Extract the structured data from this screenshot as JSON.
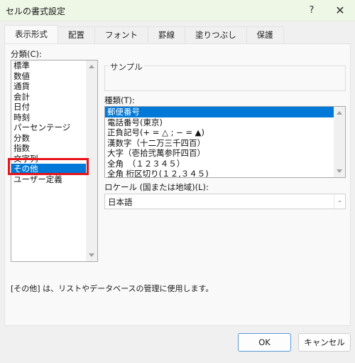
{
  "window": {
    "title": "セルの書式設定",
    "help_label": "?",
    "close_label": "✕"
  },
  "tabs": [
    {
      "label": "表示形式",
      "active": true
    },
    {
      "label": "配置",
      "active": false
    },
    {
      "label": "フォント",
      "active": false
    },
    {
      "label": "罫線",
      "active": false
    },
    {
      "label": "塗りつぶし",
      "active": false
    },
    {
      "label": "保護",
      "active": false
    }
  ],
  "category": {
    "label": "分類(C):",
    "items": [
      "標準",
      "数値",
      "通貨",
      "会計",
      "日付",
      "時刻",
      "パーセンテージ",
      "分数",
      "指数",
      "文字列",
      "その他",
      "ユーザー定義"
    ],
    "selected": "その他",
    "selected_index": 10
  },
  "sample": {
    "legend": "サンプル",
    "value": ""
  },
  "type": {
    "label": "種類(T):",
    "items": [
      "郵便番号",
      "電話番号(東京)",
      "正負記号(+ = △ ; − = ▲)",
      "漢数字（十二万三千四百）",
      "大字（壱拾弐萬参阡四百）",
      "全角　（１２３４５）",
      "全角 桁区切り(１２,３４５)"
    ],
    "selected": "郵便番号",
    "selected_index": 0
  },
  "locale": {
    "label": "ロケール (国または地域)(L):",
    "value": "日本語"
  },
  "description": "[その他] は、リストやデータベースの管理に使用します。",
  "buttons": {
    "ok": "OK",
    "cancel": "キャンセル"
  },
  "colors": {
    "selection": "#0078d7",
    "highlight_box": "#e8141b",
    "titlebar": "#eef6e6"
  }
}
